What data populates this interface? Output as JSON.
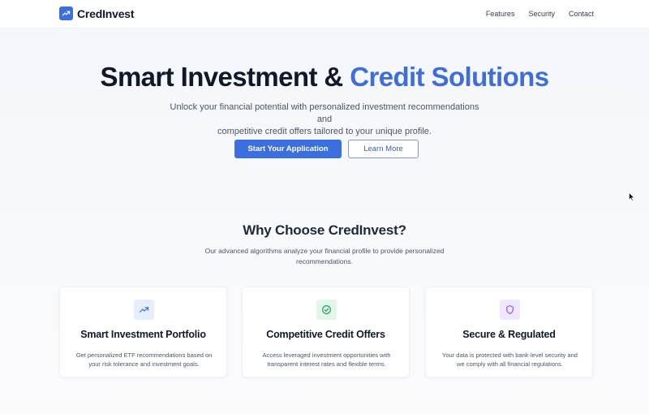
{
  "nav": {
    "brand": "CredInvest",
    "logo_icon": "trending-up-icon",
    "links": [
      "Features",
      "Security",
      "Contact"
    ]
  },
  "hero": {
    "title_main": "Smart Investment & ",
    "title_accent": "Credit Solutions",
    "subtitle_line1": "Unlock your financial potential with personalized investment recommendations and",
    "subtitle_line2": "competitive credit offers tailored to your unique profile.",
    "primary_button": "Start Your Application",
    "secondary_button": "Learn More"
  },
  "features": {
    "title": "Why Choose CredInvest?",
    "subtitle_line1": "Our advanced algorithms analyze your financial profile to provide personalized",
    "subtitle_line2": "recommendations.",
    "cards": [
      {
        "icon": "trending-up-icon",
        "title": "Smart Investment Portfolio",
        "desc_line1": "Get personalized ETF recommendations based on",
        "desc_line2": "your risk tolerance and investment goals."
      },
      {
        "icon": "check-circle-icon",
        "title": "Competitive Credit Offers",
        "desc_line1": "Access leveraged investment opportunities with",
        "desc_line2": "transparent interest rates and flexible terms."
      },
      {
        "icon": "shield-icon",
        "title": "Secure & Regulated",
        "desc_line1": "Your data is protected with bank-level security and",
        "desc_line2": "we comply with all financial regulations."
      }
    ]
  },
  "colors": {
    "accent": "#3f6ed8",
    "primary_button": "#3b6fe0",
    "green_icon": "#22a45d",
    "purple_icon": "#8b5cf6"
  }
}
